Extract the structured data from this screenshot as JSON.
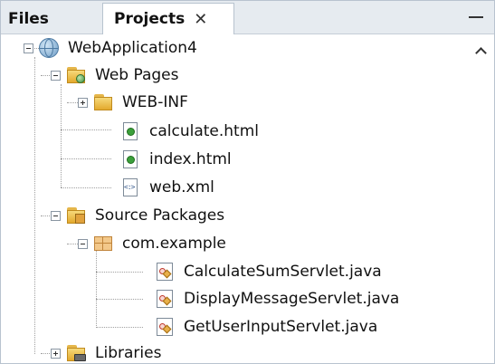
{
  "tabs": {
    "files_label": "Files",
    "projects_label": "Projects",
    "close_glyph": "✕"
  },
  "tree": {
    "project": {
      "label": "WebApplication4",
      "icon": "web-project-globe-icon"
    },
    "web_pages": {
      "label": "Web Pages",
      "icon": "web-pages-folder-icon"
    },
    "web_inf": {
      "label": "WEB-INF",
      "icon": "folder-icon"
    },
    "calculate_html": {
      "label": "calculate.html",
      "icon": "html-file-icon"
    },
    "index_html": {
      "label": "index.html",
      "icon": "html-file-icon"
    },
    "web_xml": {
      "label": "web.xml",
      "icon": "xml-file-icon"
    },
    "source_packages": {
      "label": "Source Packages",
      "icon": "source-packages-folder-icon"
    },
    "package": {
      "label": "com.example",
      "icon": "java-package-icon"
    },
    "classes": [
      {
        "label": "CalculateSumServlet.java",
        "icon": "java-class-icon"
      },
      {
        "label": "DisplayMessageServlet.java",
        "icon": "java-class-icon"
      },
      {
        "label": "GetUserInputServlet.java",
        "icon": "java-class-icon"
      }
    ],
    "libraries": {
      "label": "Libraries",
      "icon": "libraries-folder-icon"
    }
  },
  "colors": {
    "tab_bar_bg": "#e6ebf0",
    "border": "#b8c3cf",
    "folder": "#e3a92d",
    "html_badge": "#3ba03b"
  }
}
